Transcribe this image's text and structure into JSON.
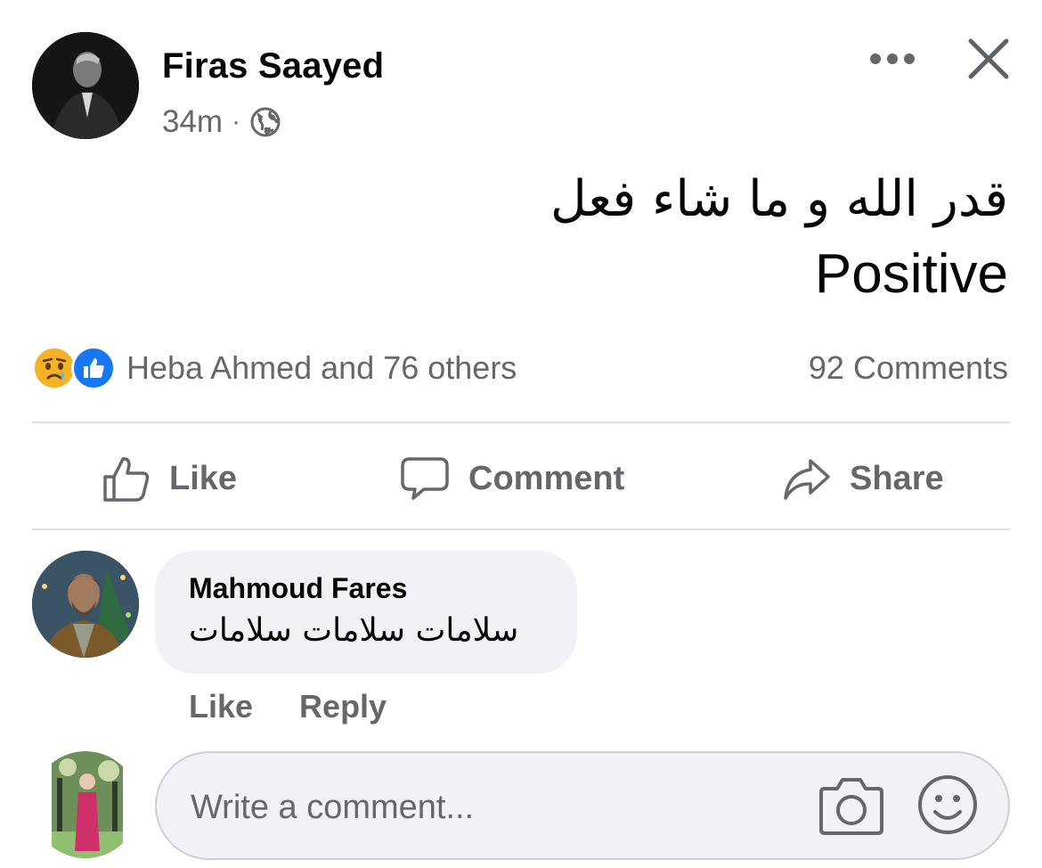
{
  "post": {
    "author": "Firas Saayed",
    "time": "34m",
    "separator": "·",
    "audience_icon": "globe-icon",
    "text_line_1": "قدر الله و ما شاء فعل",
    "text_line_2": "Positive"
  },
  "reactions": {
    "icons": [
      "sad-reaction-icon",
      "like-reaction-icon"
    ],
    "summary": "Heba Ahmed and 76 others",
    "comments_count": "92 Comments"
  },
  "actions": {
    "like": "Like",
    "comment": "Comment",
    "share": "Share"
  },
  "comment": {
    "author": "Mahmoud Fares",
    "text": "سلامات سلامات سلامات",
    "like": "Like",
    "reply": "Reply"
  },
  "composer": {
    "placeholder": "Write a comment..."
  },
  "colors": {
    "text_primary": "#050505",
    "text_secondary": "#65676b",
    "like_blue": "#1877f2",
    "sad_yellow": "#f7b125",
    "bubble_bg": "#f0f2f5",
    "divider": "#dddfe2"
  }
}
